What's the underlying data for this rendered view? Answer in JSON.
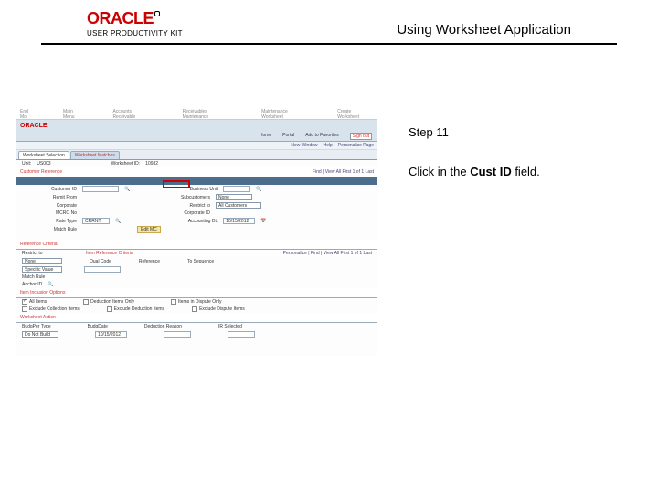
{
  "header": {
    "logo_word": "ORACLE",
    "logo_sub": "USER PRODUCTIVITY KIT",
    "doc_title": "Using Worksheet Application"
  },
  "instructions": {
    "step_label": "Step 11",
    "text_before": "Click in the ",
    "bold": "Cust ID",
    "text_after": " field."
  },
  "screenshot": {
    "topbar": {
      "a": "End Mo",
      "b": "Main Menu",
      "c": "Accounts Receivable",
      "d": "Receivables Maintenance",
      "e": "Maintenance Worksheet",
      "f": "Create Worksheet"
    },
    "oracle": "ORACLE",
    "menu": {
      "a": "Home",
      "b": "Portal",
      "c": "Add to Favorites",
      "d": "Sign out"
    },
    "crumb": {
      "a": "New Window",
      "b": "Help",
      "c": "Personalize Page"
    },
    "tabs": {
      "a": "Worksheet Selection",
      "b": "Worksheet Matches"
    },
    "unit_lab": "Unit:",
    "unit_val": "US003",
    "wsid_lab": "Worksheet ID:",
    "wsid_val": "10932",
    "hdr_customer": "Customer Reference",
    "pager_text": "Find | View All   First  1 of 1  Last",
    "custid_lab": "Customer ID",
    "custid_val": "",
    "bu_lab": "Business Unit",
    "bu_val": "",
    "rem_lab": "Remit From",
    "sub_lab": "Subcustomers",
    "sub_val": "None",
    "corp_lab": "Corporate",
    "restrict_lab": "Restrict to",
    "restrict_val": "All Customers",
    "mcro_lab": "MCRO No",
    "corpid_lab": "Corporate ID",
    "rate_lab": "Rate Type",
    "rate_val": "CRRNT",
    "acct_lab": "Accounting Dt:",
    "acct_val": "10/15/2012",
    "match_lab": "Match Rule",
    "match_btn": "Edit MC",
    "hdr_ref": "Reference Criteria",
    "ref_qual": "Qual Code",
    "ref_ref": "Reference",
    "ref_tosq": "To Sequence",
    "restrict2": "Restrict to",
    "ref_select_val": "Specific Value",
    "match_rule": "Match Rule",
    "anchor": "Anchor ID",
    "hdr_item": "Item Reference Criteria",
    "pager2": "Personalize | Find | View All   First  1 of 1  Last",
    "hdr_inc": "Item Inclusion Options",
    "inc_all": "All Items",
    "inc_ded": "Deduction Items Only",
    "inc_disp": "Items in Dispute Only",
    "inc_excl_coll": "Exclude Collection Items",
    "inc_excl_ded": "Exclude Deduction Items",
    "inc_excl_disp": "Exclude Dispute Items",
    "hdr_action": "Worksheet Action",
    "act_type": "BudgPer Type",
    "act_date": "BudgDate",
    "act_ded": "Deduction Reason",
    "act_sel": "IR Selected",
    "row_bad": "Do Not Build",
    "row_date": "10/15/2012"
  }
}
